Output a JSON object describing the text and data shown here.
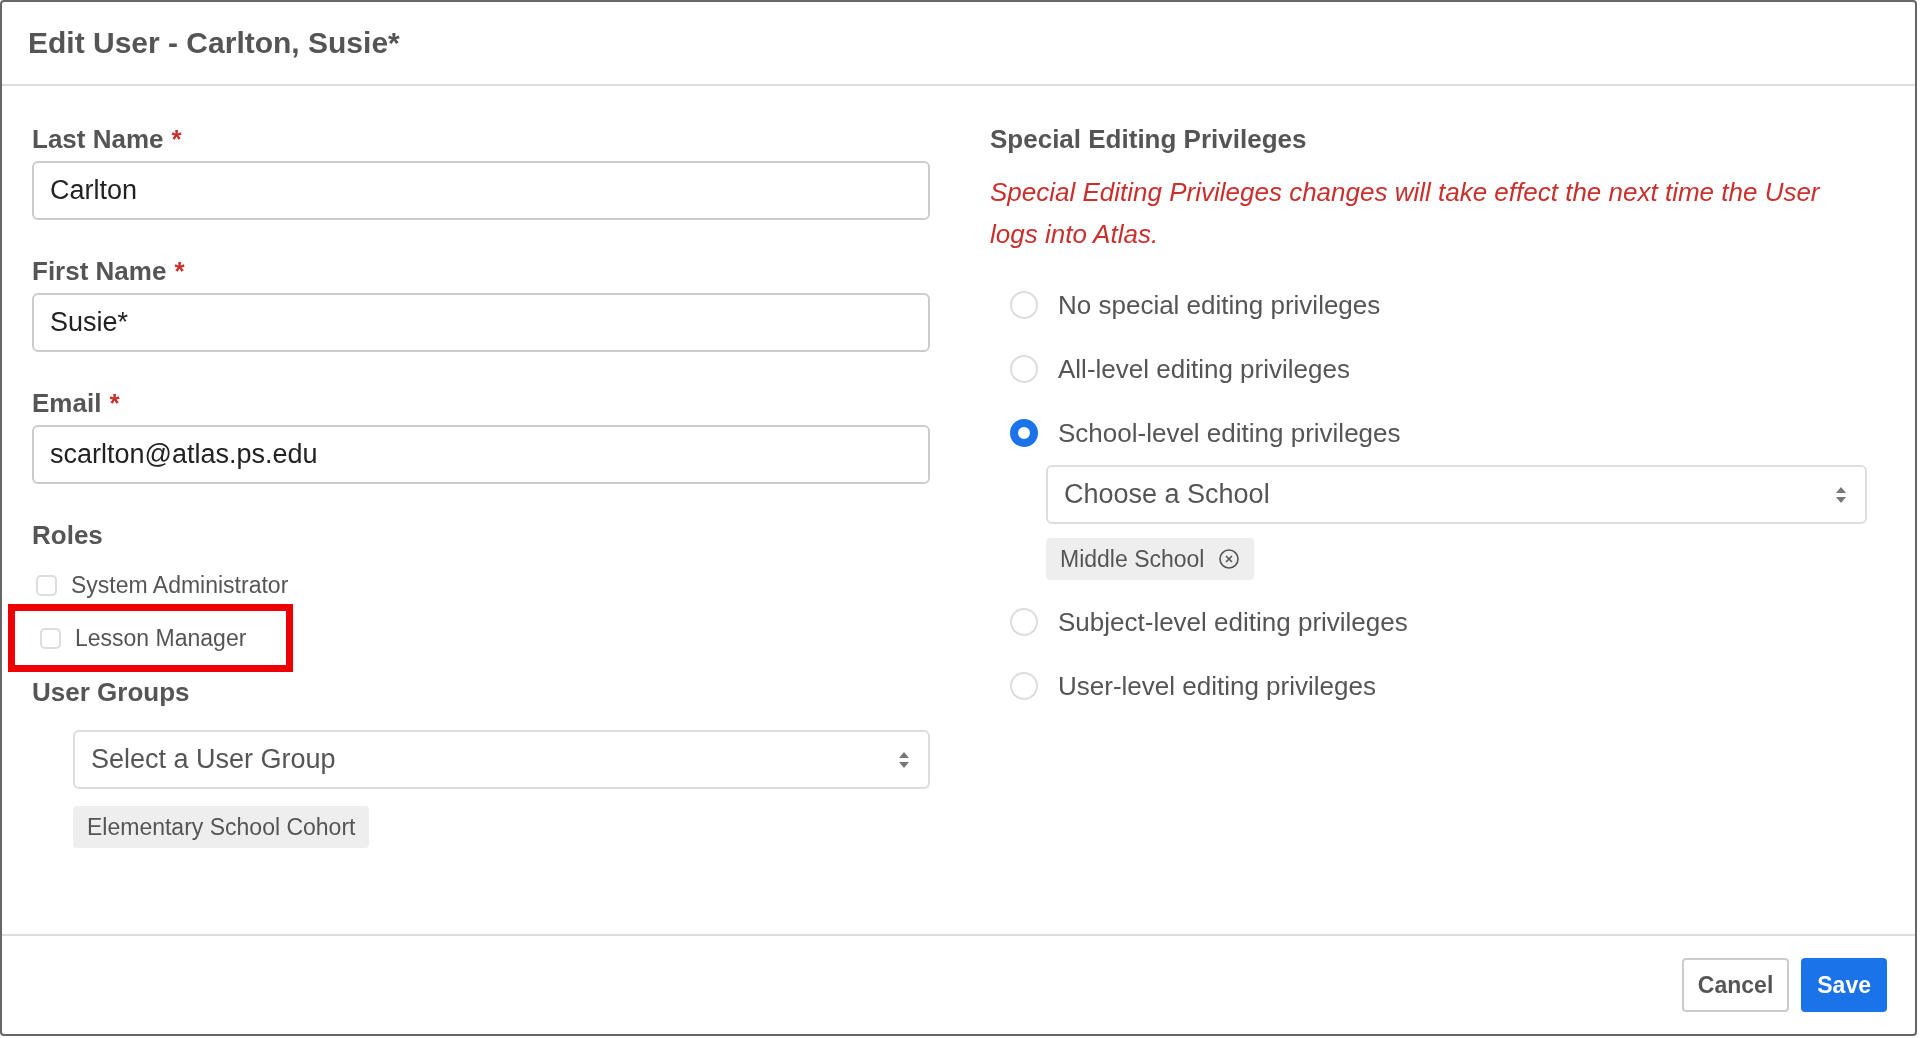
{
  "dialog": {
    "title": "Edit User - Carlton, Susie*"
  },
  "fields": [
    {
      "label": "Last Name",
      "required_mark": "*",
      "value": "Carlton"
    },
    {
      "label": "First Name",
      "required_mark": "*",
      "value": "Susie*"
    },
    {
      "label": "Email",
      "required_mark": "*",
      "value": "scarlton@atlas.ps.edu"
    }
  ],
  "roles": {
    "heading": "Roles",
    "items": [
      {
        "label": "System Administrator",
        "checked": false,
        "highlighted": false
      },
      {
        "label": "Lesson Manager",
        "checked": false,
        "highlighted": true
      }
    ]
  },
  "user_groups": {
    "heading": "User Groups",
    "placeholder": "Select a User Group",
    "chips": [
      {
        "label": "Elementary School Cohort",
        "removable": false
      }
    ]
  },
  "privileges": {
    "heading": "Special Editing Privileges",
    "notice": "Special Editing Privileges changes will take effect the next time the User logs into Atlas.",
    "options": [
      {
        "label": "No special editing privileges",
        "selected": false
      },
      {
        "label": "All-level editing privileges",
        "selected": false
      },
      {
        "label": "School-level editing privileges",
        "selected": true,
        "select": {
          "placeholder": "Choose a School",
          "chips": [
            {
              "label": "Middle School",
              "removable": true
            }
          ]
        }
      },
      {
        "label": "Subject-level editing privileges",
        "selected": false
      },
      {
        "label": "User-level editing privileges",
        "selected": false
      }
    ]
  },
  "buttons": [
    {
      "label": "Cancel",
      "kind": "secondary"
    },
    {
      "label": "Save",
      "kind": "primary"
    }
  ]
}
